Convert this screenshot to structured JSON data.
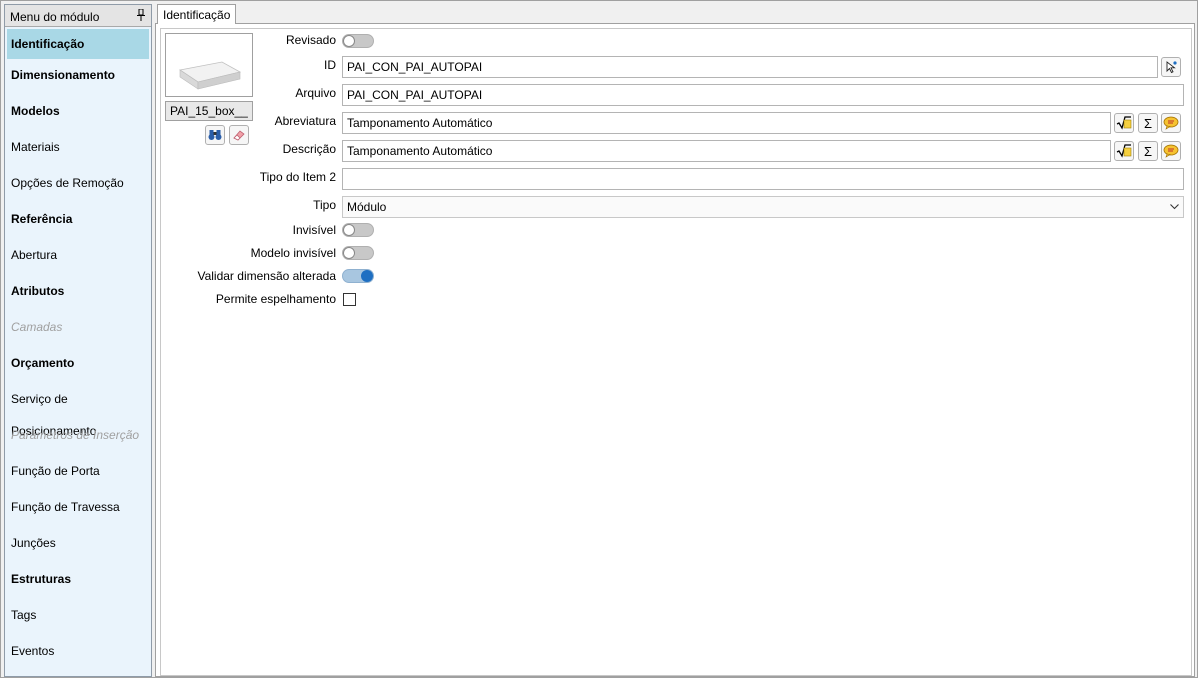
{
  "sidebar": {
    "title": "Menu do módulo",
    "items": [
      {
        "label": "Identificação",
        "style": "bold",
        "active": true
      },
      {
        "label": "Dimensionamento",
        "style": "bold"
      },
      {
        "label": "Modelos",
        "style": "bold"
      },
      {
        "label": "Materiais",
        "style": "normal"
      },
      {
        "label": "Opções de Remoção",
        "style": "normal"
      },
      {
        "label": "Referência",
        "style": "bold"
      },
      {
        "label": "Abertura",
        "style": "normal"
      },
      {
        "label": "Atributos",
        "style": "bold"
      },
      {
        "label": "Camadas",
        "style": "disabled"
      },
      {
        "label": "Orçamento",
        "style": "bold"
      },
      {
        "label": "Serviço de Posicionamento",
        "style": "normal"
      },
      {
        "label": "Parâmetros de Inserção",
        "style": "disabled"
      },
      {
        "label": "Função de Porta",
        "style": "normal"
      },
      {
        "label": "Função de Travessa",
        "style": "normal"
      },
      {
        "label": "Junções",
        "style": "normal"
      },
      {
        "label": "Estruturas",
        "style": "bold"
      },
      {
        "label": "Tags",
        "style": "normal"
      },
      {
        "label": "Eventos",
        "style": "normal"
      }
    ]
  },
  "tab": {
    "label": "Identificação"
  },
  "preview": {
    "name": "PAI_15_box__"
  },
  "form": {
    "revisado": {
      "label": "Revisado",
      "value": false
    },
    "id": {
      "label": "ID",
      "value": "PAI_CON_PAI_AUTOPAI"
    },
    "arquivo": {
      "label": "Arquivo",
      "value": "PAI_CON_PAI_AUTOPAI"
    },
    "abreviatura": {
      "label": "Abreviatura",
      "value": "Tamponamento Automático"
    },
    "descricao": {
      "label": "Descrição",
      "value": "Tamponamento Automático"
    },
    "tipo_item2": {
      "label": "Tipo do Item 2",
      "value": ""
    },
    "tipo": {
      "label": "Tipo",
      "value": "Módulo"
    },
    "invisivel": {
      "label": "Invisível",
      "value": false
    },
    "modelo_invisivel": {
      "label": "Modelo invisível",
      "value": false
    },
    "validar_dimensao": {
      "label": "Validar dimensão alterada",
      "value": true
    },
    "permite_espelhamento": {
      "label": "Permite espelhamento",
      "value": false
    }
  },
  "icons": {
    "sigma": "Σ",
    "accent": "#1f6fc2",
    "active_item_bg": "#a9d8e6"
  }
}
